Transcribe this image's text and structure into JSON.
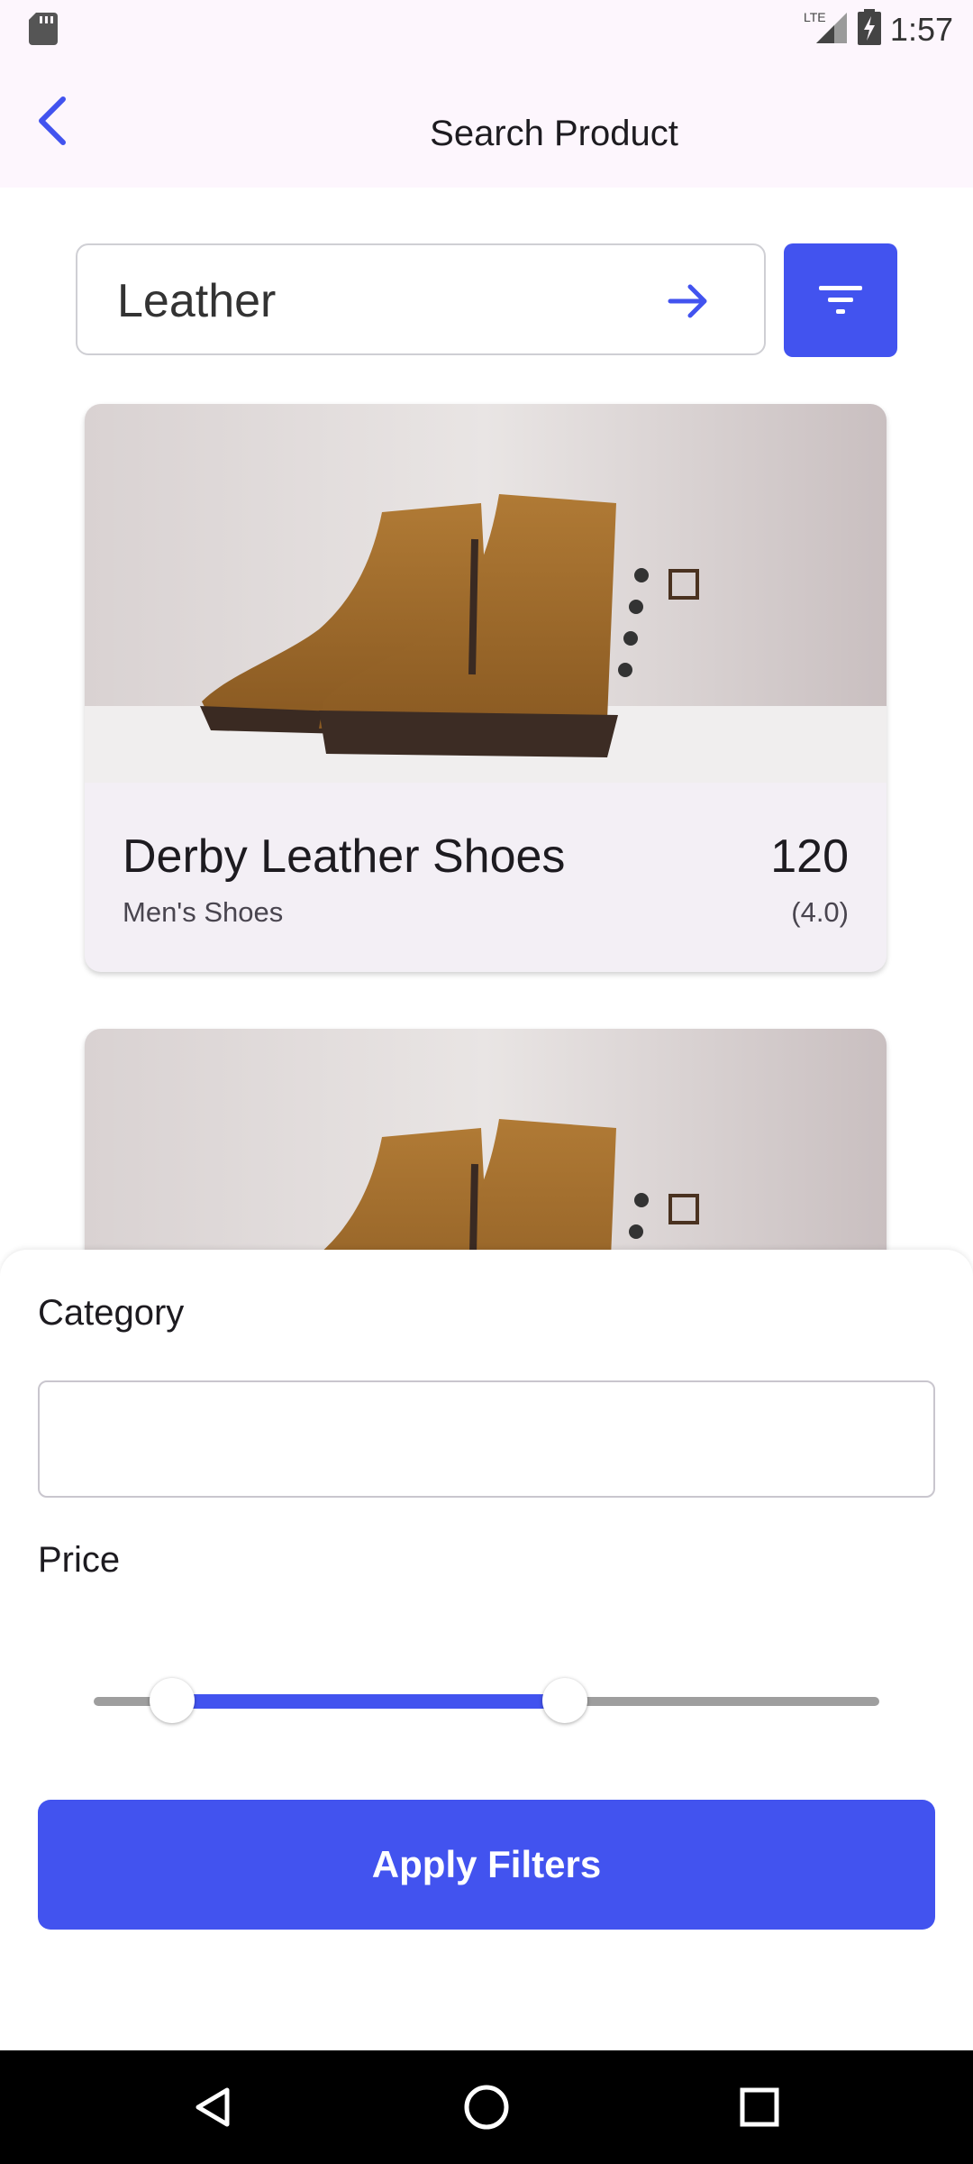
{
  "status_bar": {
    "time": "1:57",
    "network": "LTE"
  },
  "app_bar": {
    "title": "Search Product"
  },
  "search": {
    "value": "Leather"
  },
  "products": [
    {
      "name": "Derby Leather Shoes",
      "price": "120",
      "category": "Men's Shoes",
      "rating": "(4.0)"
    },
    {
      "name": "",
      "price": "",
      "category": "",
      "rating": ""
    }
  ],
  "filter_sheet": {
    "category_label": "Category",
    "category_value": "",
    "price_label": "Price",
    "price_range_fraction": {
      "low": 0.1,
      "high": 0.6
    },
    "apply_label": "Apply Filters"
  },
  "colors": {
    "accent": "#4253ef",
    "app_bar_bg": "#fdf6fd",
    "card_bg": "#f3eff5"
  }
}
